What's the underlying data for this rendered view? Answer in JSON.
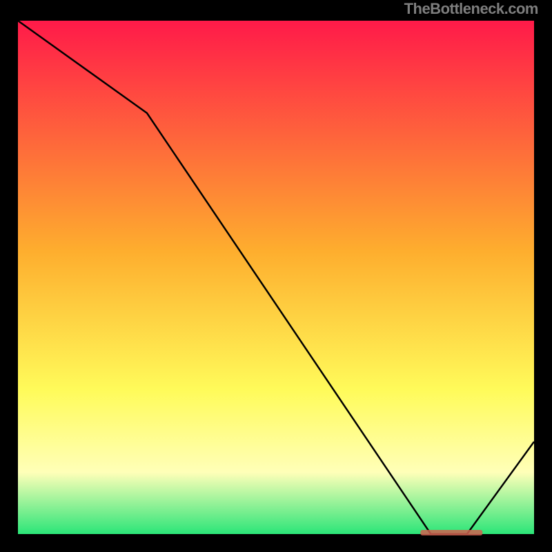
{
  "attribution": "TheBottleneck.com",
  "chart_data": {
    "type": "line",
    "title": "",
    "xlabel": "",
    "ylabel": "",
    "x": [
      0,
      25,
      80,
      87,
      100
    ],
    "y": [
      100,
      82,
      0,
      0,
      18
    ],
    "xlim": [
      0,
      100
    ],
    "ylim": [
      0,
      100
    ],
    "annotations": [
      {
        "text": "",
        "x": 84,
        "y": 0,
        "color": "#d06050"
      }
    ],
    "background_gradient": {
      "top": "#ff1a49",
      "mid1": "#feae2e",
      "mid2": "#fffb5a",
      "mid3": "#ffffb8",
      "bottom": "#2be578"
    },
    "frame": "#000000"
  }
}
